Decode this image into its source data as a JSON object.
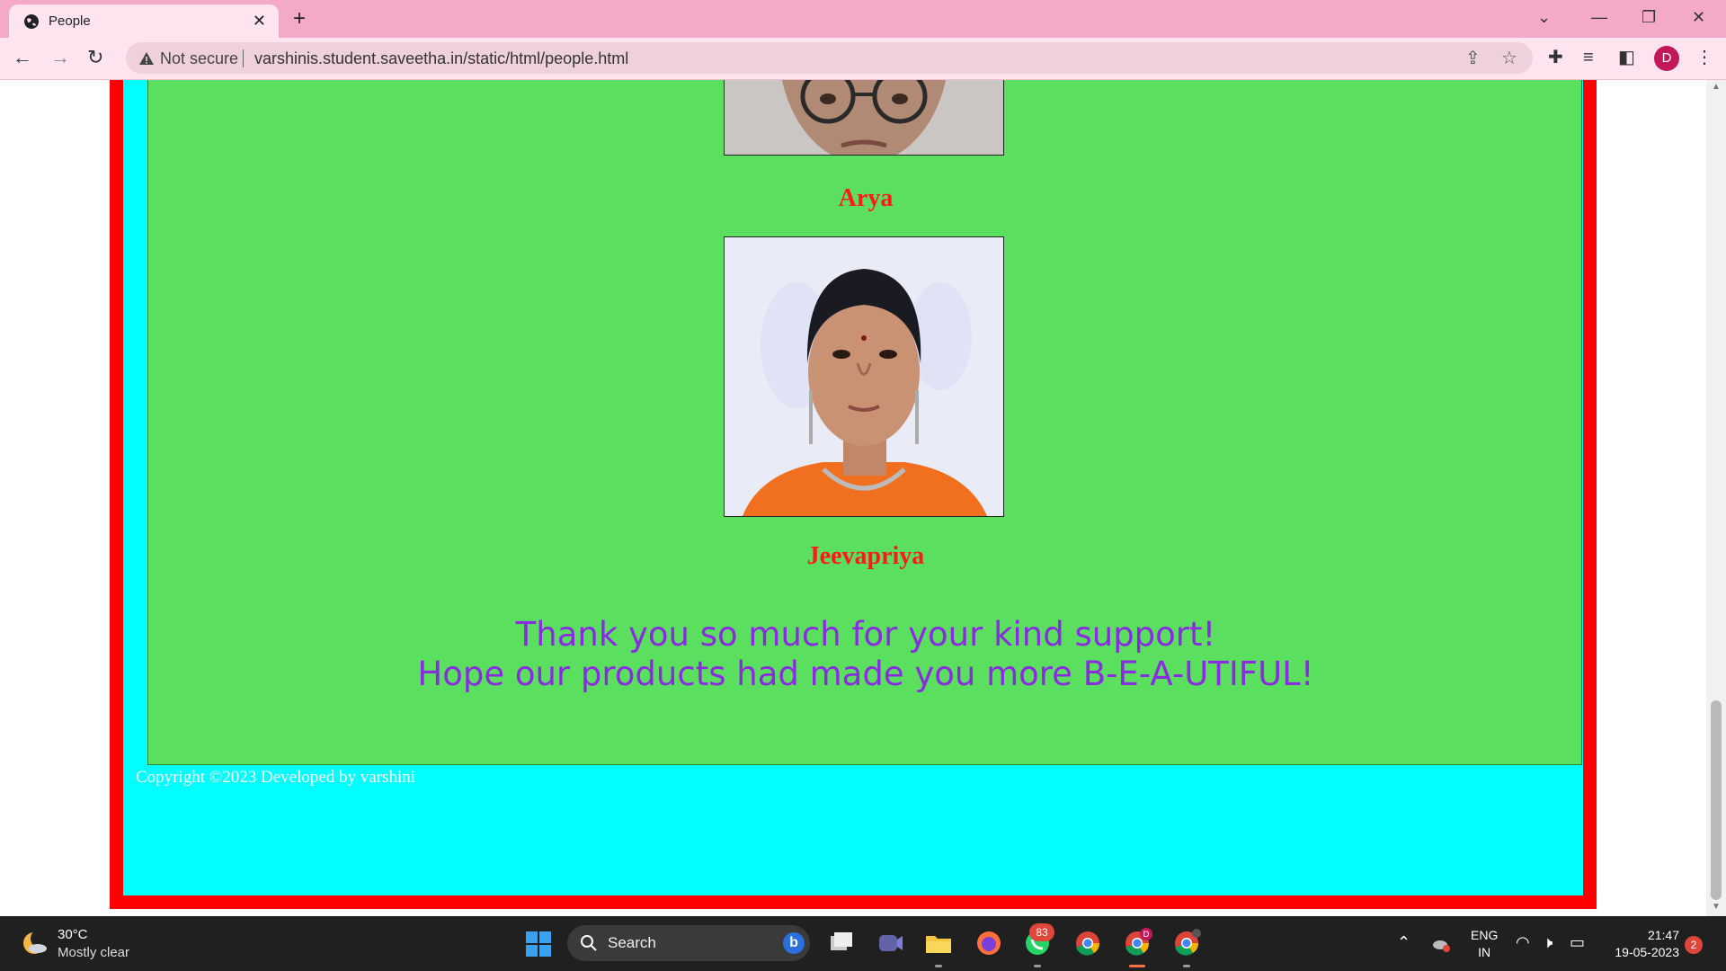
{
  "browser": {
    "tab_title": "People",
    "not_secure_label": "Not secure",
    "url": "varshinis.student.saveetha.in/static/html/people.html",
    "profile_initial": "D"
  },
  "page": {
    "people": [
      {
        "name": "Arya"
      },
      {
        "name": "Jeevapriya"
      }
    ],
    "thanks_line1": "Thank you so much for your kind support!",
    "thanks_line2": "Hope our products had made you more B-E-A-UTIFUL!",
    "copyright": "Copyright ©2023 Developed by varshini",
    "colors": {
      "border": "#ff0000",
      "outer_bg": "#00ffff",
      "content_bg": "#5ae05e",
      "name_color": "#ff1a1a",
      "thanks_color": "#8a2be2"
    }
  },
  "taskbar": {
    "temperature": "30°C",
    "condition": "Mostly clear",
    "search_label": "Search",
    "whatsapp_badge": "83",
    "chrome_profile_badge": "D",
    "lang_line1": "ENG",
    "lang_line2": "IN",
    "time": "21:47",
    "date": "19-05-2023",
    "notification_count": "2"
  }
}
